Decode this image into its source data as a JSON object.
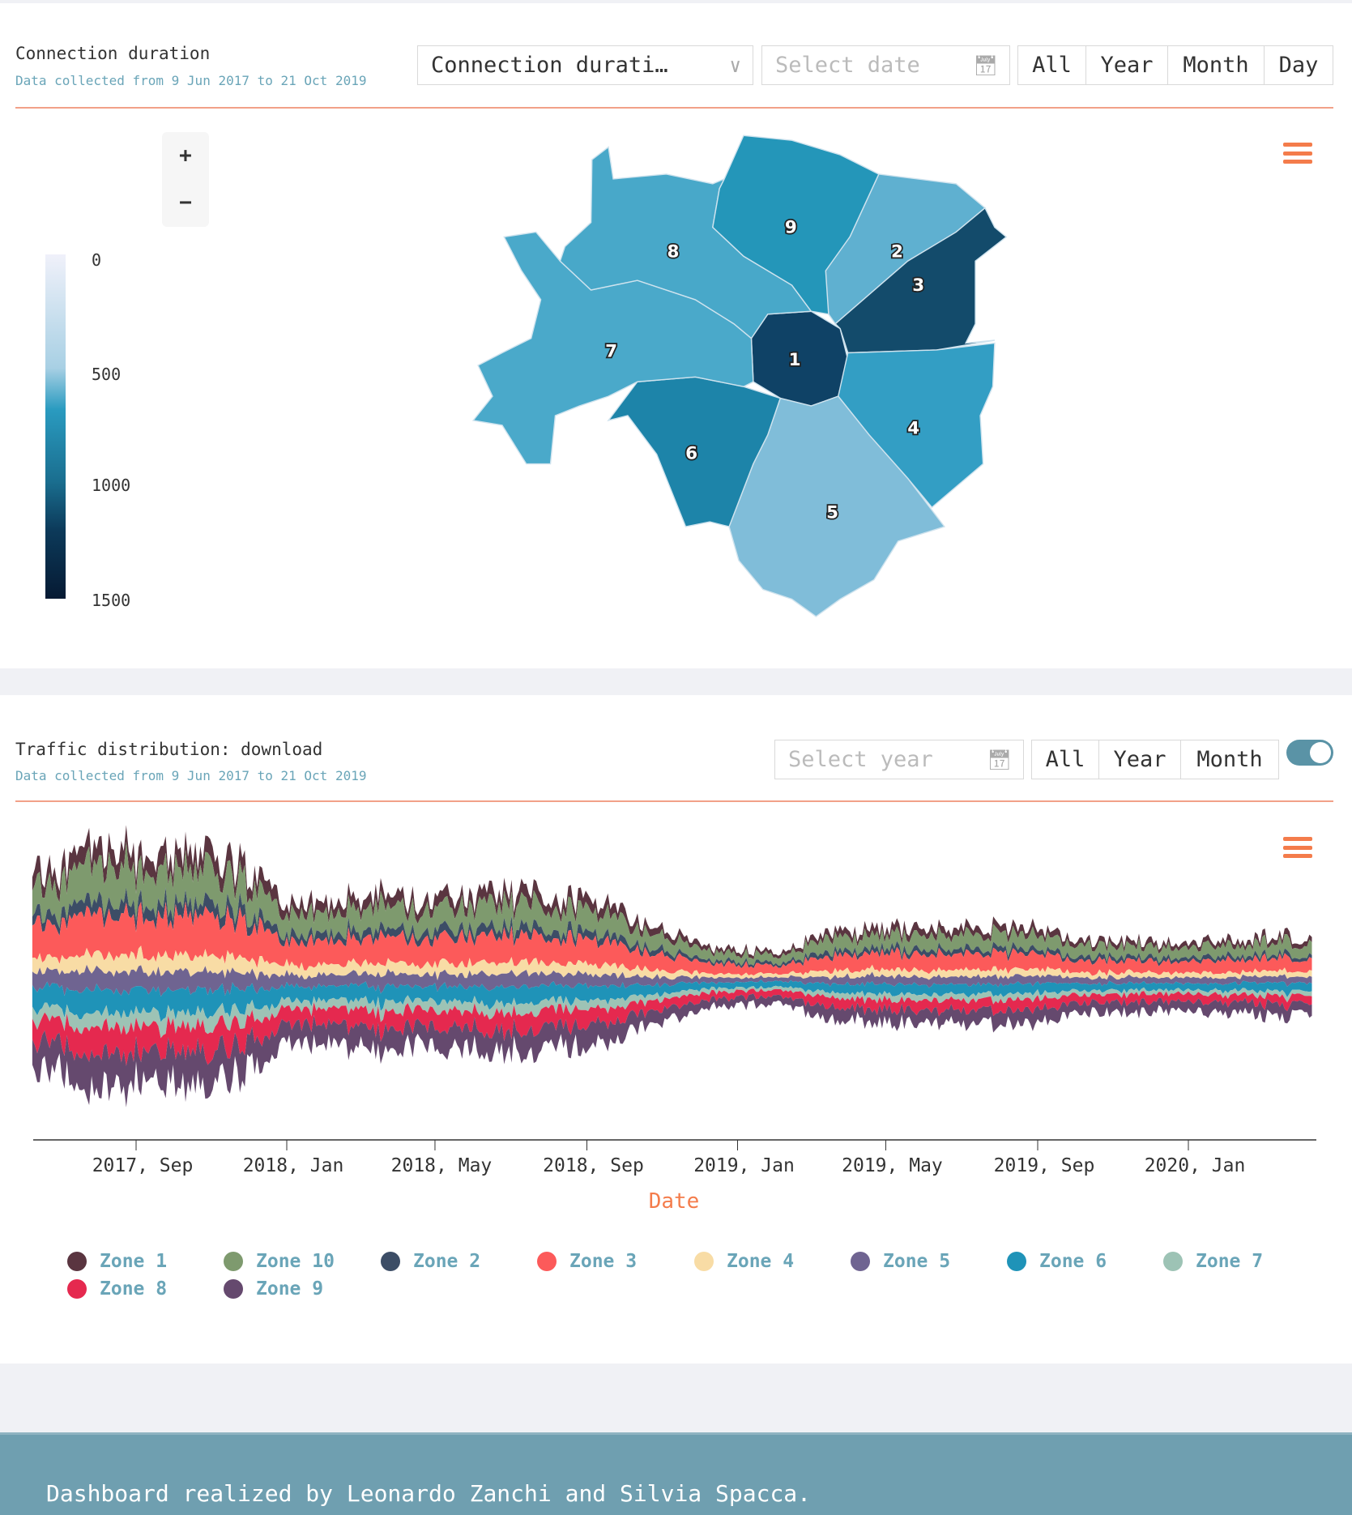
{
  "map_panel": {
    "title": "Connection duration",
    "subtitle": "Data collected from 9 Jun 2017 to 21 Oct 2019",
    "metric_select": "Connection durati…",
    "date_placeholder": "Select date",
    "range_buttons": [
      "All",
      "Year",
      "Month",
      "Day"
    ],
    "zoom_in": "+",
    "zoom_out": "−",
    "colorbar_labels": [
      "0",
      "500",
      "1000",
      "1500"
    ],
    "colorbar_range": [
      0,
      1500
    ],
    "zones": [
      {
        "label": "1",
        "color": "#0f4266"
      },
      {
        "label": "2",
        "color": "#5fb0d0"
      },
      {
        "label": "3",
        "color": "#134b6b"
      },
      {
        "label": "4",
        "color": "#339ec4"
      },
      {
        "label": "5",
        "color": "#80bdd9"
      },
      {
        "label": "6",
        "color": "#1d84a9"
      },
      {
        "label": "7",
        "color": "#4aa9ca"
      },
      {
        "label": "8",
        "color": "#48a8c9"
      },
      {
        "label": "9",
        "color": "#2496b9"
      }
    ]
  },
  "stream_panel": {
    "title": "Traffic distribution: download",
    "subtitle": "Data collected from 9 Jun 2017 to 21 Oct 2019",
    "year_placeholder": "Select year",
    "range_buttons": [
      "All",
      "Year",
      "Month"
    ],
    "toggle_on": true
  },
  "chart_data": {
    "type": "area",
    "subtype": "streamgraph",
    "xlabel": "Date",
    "ylabel": "",
    "x_ticks": [
      "2017, Sep",
      "2018, Jan",
      "2018, May",
      "2018, Sep",
      "2019, Jan",
      "2019, May",
      "2019, Sep",
      "2020, Jan"
    ],
    "x": [
      "2017-06",
      "2017-07",
      "2017-08",
      "2017-09",
      "2017-10",
      "2017-11",
      "2017-12",
      "2018-01",
      "2018-02",
      "2018-03",
      "2018-04",
      "2018-05",
      "2018-06",
      "2018-07",
      "2018-08",
      "2018-09",
      "2018-10",
      "2018-11",
      "2018-12",
      "2019-01",
      "2019-02",
      "2019-03",
      "2019-04",
      "2019-05",
      "2019-06",
      "2019-07",
      "2019-08",
      "2019-09",
      "2019-10",
      "2019-11",
      "2019-12",
      "2020-01",
      "2020-02",
      "2020-03",
      "2020-04"
    ],
    "legend_position": "bottom",
    "series": [
      {
        "name": "Zone 1",
        "color": "#5a3540",
        "values": [
          14,
          16,
          18,
          17,
          17,
          16,
          13,
          10,
          11,
          11,
          11,
          11,
          11,
          11,
          11,
          10,
          8,
          6,
          4,
          4,
          4,
          6,
          7,
          7,
          7,
          7,
          7,
          6,
          5,
          5,
          5,
          5,
          5,
          6,
          6
        ]
      },
      {
        "name": "Zone 10",
        "color": "#7e9a6e",
        "values": [
          30,
          35,
          38,
          36,
          36,
          35,
          27,
          21,
          23,
          24,
          24,
          23,
          24,
          24,
          23,
          21,
          17,
          12,
          9,
          8,
          9,
          14,
          14,
          14,
          15,
          15,
          15,
          13,
          11,
          11,
          11,
          11,
          11,
          13,
          13
        ]
      },
      {
        "name": "Zone 2",
        "color": "#3c4d66",
        "values": [
          10,
          12,
          13,
          12,
          12,
          12,
          9,
          7,
          8,
          8,
          8,
          8,
          8,
          8,
          8,
          7,
          6,
          4,
          3,
          3,
          3,
          5,
          5,
          5,
          5,
          5,
          5,
          4,
          4,
          4,
          4,
          4,
          4,
          4,
          4
        ]
      },
      {
        "name": "Zone 3",
        "color": "#fc5a5a",
        "values": [
          34,
          39,
          43,
          41,
          41,
          39,
          31,
          24,
          26,
          27,
          27,
          26,
          27,
          27,
          26,
          24,
          19,
          14,
          10,
          9,
          10,
          15,
          16,
          16,
          17,
          17,
          17,
          14,
          12,
          12,
          12,
          12,
          13,
          14,
          14
        ]
      },
      {
        "name": "Zone 4",
        "color": "#f8dca5",
        "values": [
          14,
          16,
          18,
          17,
          17,
          16,
          13,
          10,
          11,
          11,
          11,
          11,
          11,
          11,
          11,
          10,
          8,
          6,
          4,
          4,
          4,
          6,
          7,
          7,
          7,
          7,
          7,
          6,
          5,
          5,
          5,
          5,
          5,
          6,
          6
        ]
      },
      {
        "name": "Zone 5",
        "color": "#6f6491",
        "values": [
          16,
          18,
          20,
          19,
          19,
          18,
          14,
          11,
          12,
          13,
          13,
          12,
          13,
          13,
          12,
          11,
          9,
          6,
          5,
          4,
          5,
          7,
          8,
          8,
          8,
          8,
          8,
          7,
          6,
          6,
          6,
          6,
          6,
          7,
          7
        ]
      },
      {
        "name": "Zone 6",
        "color": "#1f93b8",
        "values": [
          20,
          23,
          25,
          24,
          24,
          23,
          18,
          14,
          15,
          16,
          16,
          15,
          16,
          16,
          16,
          14,
          11,
          8,
          6,
          6,
          6,
          9,
          10,
          10,
          10,
          10,
          10,
          9,
          7,
          7,
          7,
          7,
          8,
          9,
          9
        ]
      },
      {
        "name": "Zone 7",
        "color": "#9dc3b5",
        "values": [
          12,
          14,
          15,
          14,
          14,
          14,
          11,
          8,
          9,
          10,
          10,
          9,
          10,
          10,
          9,
          8,
          7,
          5,
          4,
          3,
          4,
          5,
          6,
          6,
          6,
          6,
          6,
          5,
          4,
          4,
          4,
          4,
          5,
          5,
          5
        ]
      },
      {
        "name": "Zone 8",
        "color": "#e5294f",
        "values": [
          22,
          25,
          28,
          26,
          26,
          25,
          20,
          15,
          17,
          18,
          18,
          17,
          18,
          18,
          17,
          15,
          12,
          9,
          7,
          6,
          7,
          10,
          10,
          10,
          11,
          11,
          11,
          9,
          8,
          8,
          8,
          8,
          8,
          9,
          9
        ]
      },
      {
        "name": "Zone 9",
        "color": "#65496e",
        "values": [
          28,
          32,
          35,
          34,
          34,
          32,
          25,
          20,
          21,
          22,
          22,
          21,
          22,
          22,
          22,
          20,
          15,
          11,
          8,
          8,
          8,
          13,
          13,
          13,
          14,
          14,
          14,
          12,
          10,
          10,
          10,
          10,
          11,
          12,
          12
        ]
      }
    ]
  },
  "footer": {
    "text": "Dashboard realized by Leonardo Zanchi and Silvia Spacca."
  }
}
